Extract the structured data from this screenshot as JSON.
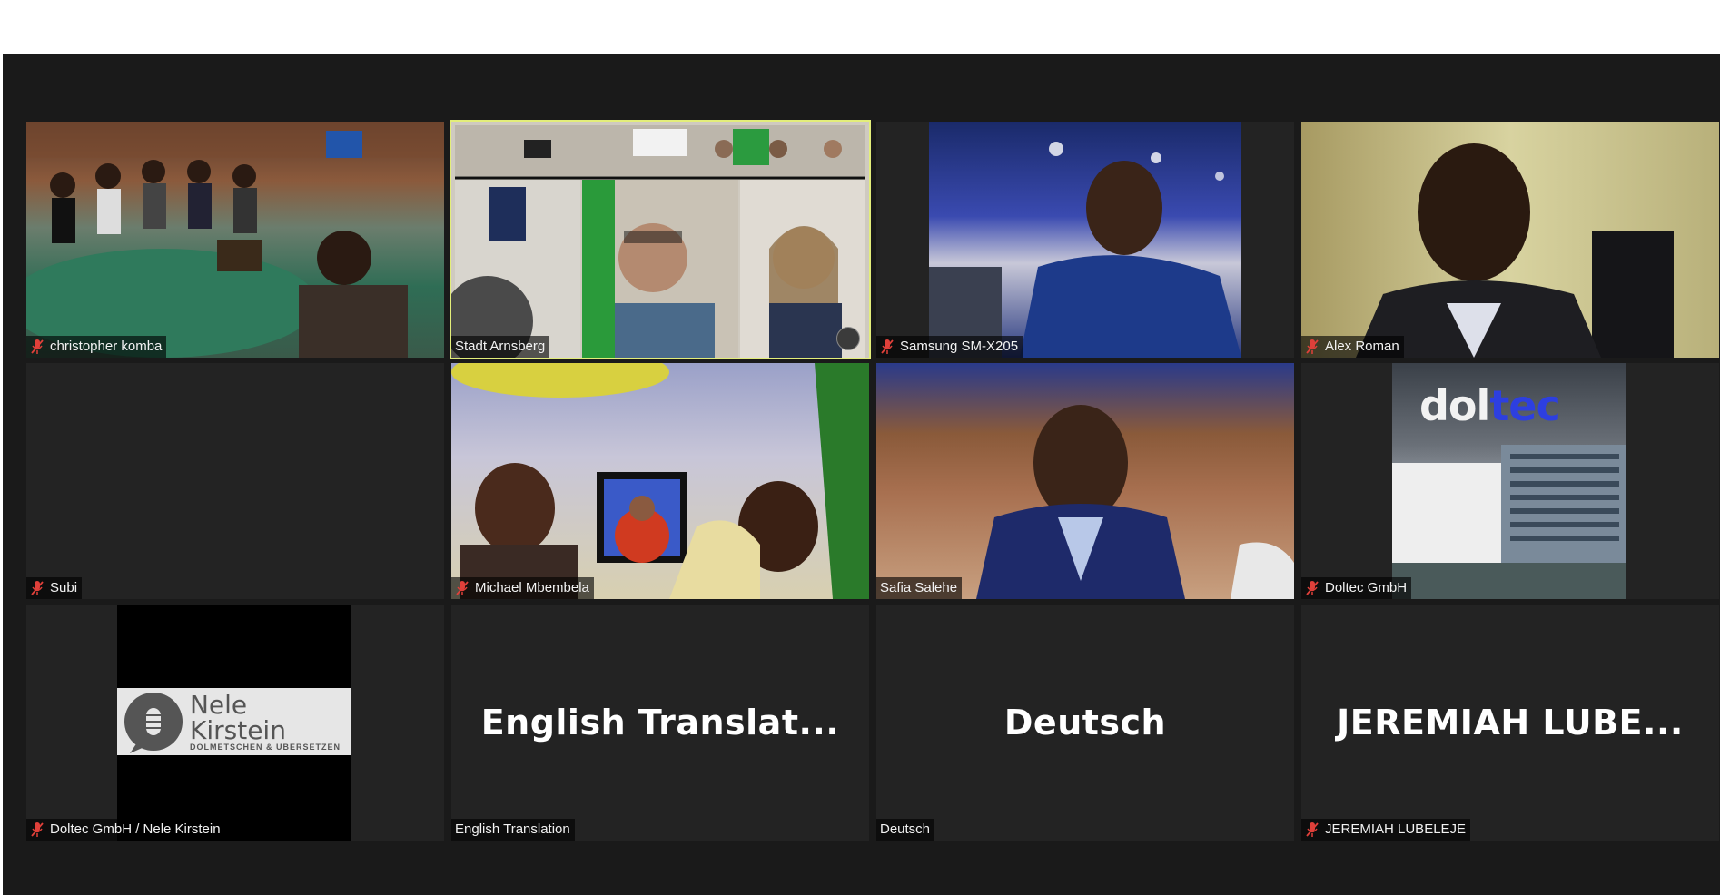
{
  "colors": {
    "app_background": "#1a1a1a",
    "tile_background": "#232323",
    "active_speaker_border": "#e3ee7a",
    "muted_icon": "#e0403a",
    "doltec_blue": "#2d3fe0"
  },
  "participants": [
    {
      "name": "christopher komba",
      "muted": true
    },
    {
      "name": "Stadt Arnsberg",
      "muted": false,
      "active_speaker": true
    },
    {
      "name": "Samsung SM-X205",
      "muted": true
    },
    {
      "name": "Alex Roman",
      "muted": true
    },
    {
      "name": "Subi",
      "muted": true
    },
    {
      "name": "Michael Mbembela",
      "muted": true
    },
    {
      "name": "Safia Salehe",
      "muted": false
    },
    {
      "name": "Doltec GmbH",
      "muted": true,
      "logo_part1": "dol",
      "logo_part2": "tec"
    },
    {
      "name": "Doltec GmbH / Nele Kirstein",
      "muted": true,
      "logo_main": "Nele Kirstein",
      "logo_sub": "DOLMETSCHEN & ÜBERSETZEN"
    },
    {
      "name": "English Translation",
      "muted": false,
      "display_name": "English  Translat..."
    },
    {
      "name": "Deutsch",
      "muted": false,
      "display_name": "Deutsch"
    },
    {
      "name": "JEREMIAH LUBELEJE",
      "muted": true,
      "display_name": "JEREMIAH  LUBE..."
    }
  ]
}
